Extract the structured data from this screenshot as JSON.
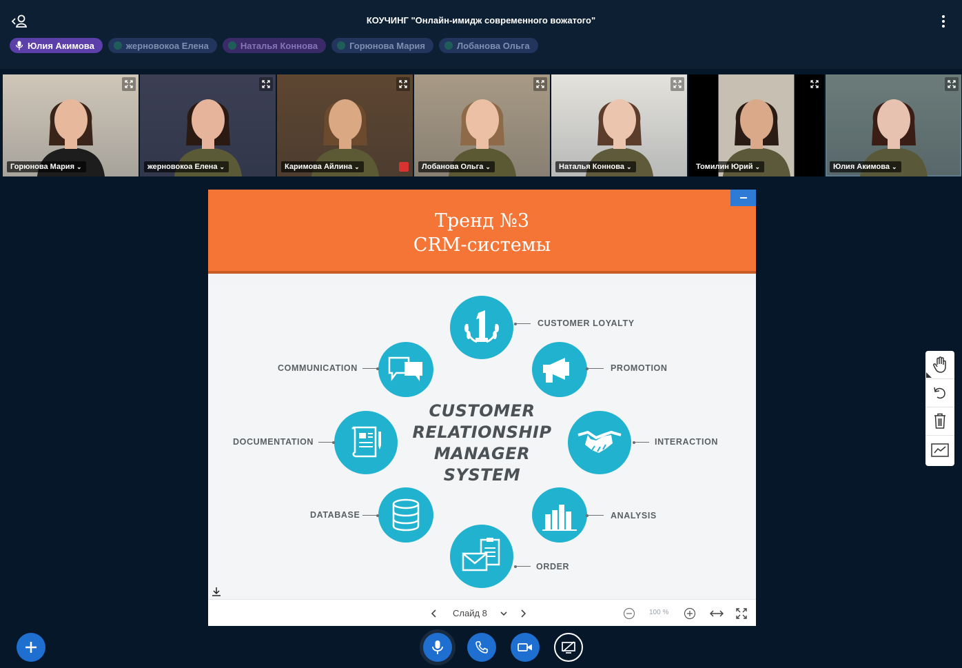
{
  "header": {
    "title": "КОУЧИНГ \"Онлайн-имидж современного вожатого\""
  },
  "talkers": [
    {
      "name": "Юлия Акимова",
      "active": true
    },
    {
      "name": "жерновокоа Елена",
      "active": false
    },
    {
      "name": "Наталья Коннова",
      "active": false
    },
    {
      "name": "Горюнова Мария",
      "active": false
    },
    {
      "name": "Лобанова Ольга",
      "active": false
    }
  ],
  "videos": [
    {
      "name": "Горюнова Мария",
      "bg": "#cfc6b8",
      "skin": "#e8b89c",
      "hair": "#3a241a",
      "shirt": "#1d1d1d"
    },
    {
      "name": "жерновокоа Елена",
      "bg": "#3c3f54",
      "skin": "#e6b49a",
      "hair": "#2b1a12",
      "shirt": "#5a5a36"
    },
    {
      "name": "Каримова Айлина",
      "bg": "#5e4631",
      "skin": "#dba884",
      "hair": "#6b4a2e",
      "shirt": "#5c5a34"
    },
    {
      "name": "Лобанова Ольга",
      "bg": "#a89a85",
      "skin": "#ecc0a4",
      "hair": "#8e6a48",
      "shirt": "#5b5834"
    },
    {
      "name": "Наталья Коннова",
      "bg": "#e4e2dc",
      "skin": "#ebc5ad",
      "hair": "#5c3d2c",
      "shirt": "#5f5b3a"
    },
    {
      "name": "Томилин Юрий",
      "bg": "#c7c0b2",
      "skin": "#d9a98a",
      "hair": "#2a1c14",
      "shirt": "#5c593a"
    },
    {
      "name": "Юлия Акимова",
      "bg": "#6c7c7a",
      "skin": "#e8c2b0",
      "hair": "#3a1e16",
      "shirt": "#595838"
    }
  ],
  "slide": {
    "title_line1": "Тренд №3",
    "title_line2": "CRM-системы",
    "center_text": [
      "CUSTOMER",
      "RELATIONSHIP",
      "MANAGER",
      "SYSTEM"
    ],
    "items": [
      {
        "label": "CUSTOMER LOYALTY",
        "icon": "number-one-laurel-icon"
      },
      {
        "label": "PROMOTION",
        "icon": "megaphone-icon"
      },
      {
        "label": "INTERACTION",
        "icon": "handshake-icon"
      },
      {
        "label": "ANALYSIS",
        "icon": "bar-chart-icon"
      },
      {
        "label": "ORDER",
        "icon": "envelope-clipboard-icon"
      },
      {
        "label": "DATABASE",
        "icon": "database-icon"
      },
      {
        "label": "DOCUMENTATION",
        "icon": "document-scroll-icon"
      },
      {
        "label": "COMMUNICATION",
        "icon": "chat-bubbles-icon"
      }
    ],
    "accent": "#20b2cf",
    "header_color": "#f47535"
  },
  "slide_controls": {
    "slide_label": "Слайд 8",
    "zoom": "100 %"
  },
  "colors": {
    "background": "#06172a",
    "primary": "#1f6fd1"
  }
}
